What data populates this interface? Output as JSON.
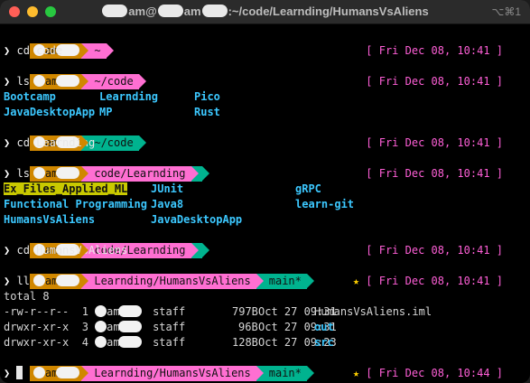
{
  "window": {
    "title_prefix": "",
    "title_mid": "am",
    "title_path": ":~/code/Learnding/HumansVsAliens",
    "shortcut": "⌥⌘1"
  },
  "prompt_symbol": "❯",
  "user_fragment": "am",
  "timestamp": "[ Fri Dec 08, 10:41 ]",
  "timestamp_last": "[ Fri Dec 08, 10:44 ]",
  "star": "★",
  "paths": {
    "home": "~",
    "code": "~/code",
    "learnding_short": "code/Learnding",
    "hva": "Learnding/HumansVsAliens"
  },
  "git_branch": "main*",
  "commands": {
    "c1": "cd code",
    "c2": "ls",
    "c3": "cd Learnding",
    "c4": "ls",
    "c5": "cd HumansVsAliens",
    "c6": "ll"
  },
  "ls1": {
    "col1": [
      "Bootcamp",
      "JavaDesktopApp"
    ],
    "col2": [
      "Learnding",
      "MP"
    ],
    "col3": [
      "Pico",
      "Rust"
    ]
  },
  "ls2": {
    "col1": [
      "Ex_Files_Applied_ML",
      "Functional Programming",
      "HumansVsAliens"
    ],
    "col2": [
      "JUnit",
      "Java8",
      "JavaDesktopApp"
    ],
    "col3": [
      "gRPC",
      "learn-git"
    ]
  },
  "ll": {
    "total": "total 8",
    "rows": [
      {
        "perm": "-rw-r--r--",
        "links": "1",
        "group": "staff",
        "size": "797B",
        "date": "Oct 27 09:31",
        "name": "HumansVsAliens.iml"
      },
      {
        "perm": "drwxr-xr-x",
        "links": "3",
        "group": "staff",
        "size": "96B",
        "date": "Oct 27 09:31",
        "name": "out"
      },
      {
        "perm": "drwxr-xr-x",
        "links": "4",
        "group": "staff",
        "size": "128B",
        "date": "Oct 27 09:23",
        "name": "src"
      }
    ]
  }
}
